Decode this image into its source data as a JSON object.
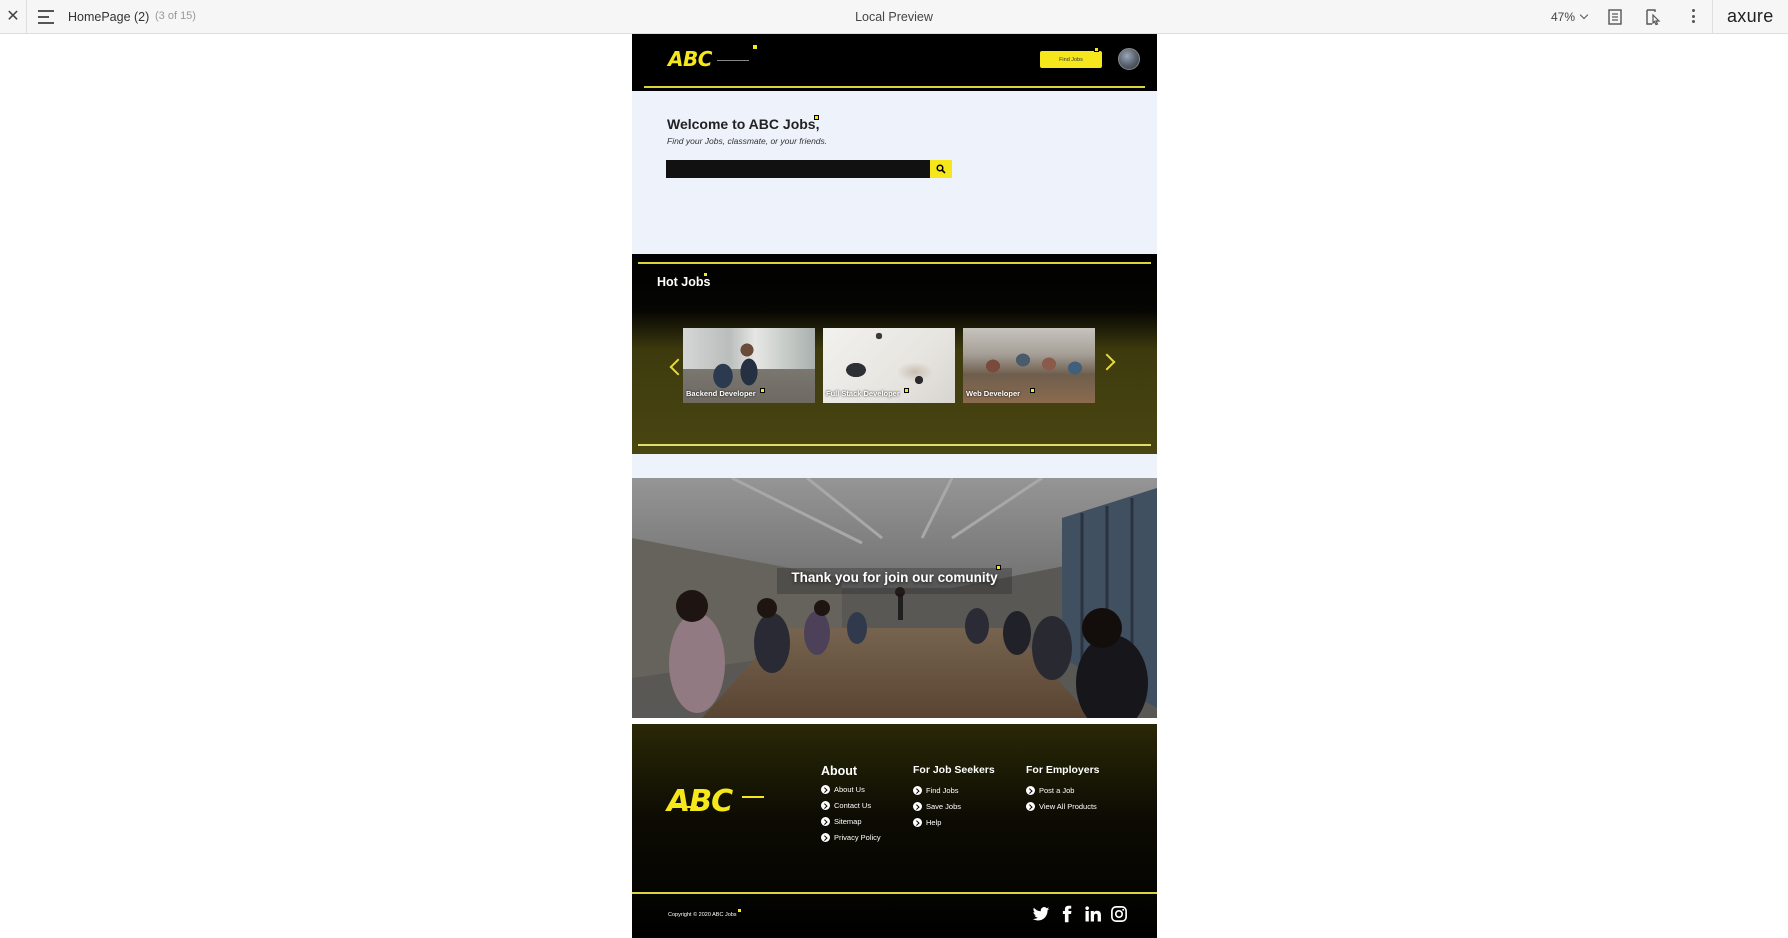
{
  "toolbar": {
    "page_name": "HomePage (2)",
    "page_count": "(3 of 15)",
    "center_title": "Local Preview",
    "zoom": "47%",
    "brand": "axure"
  },
  "site": {
    "logo": "ABC",
    "find_jobs_button": "Find Jobs",
    "welcome_title": "Welcome to ABC Jobs,",
    "welcome_subtitle": "Find your Jobs, classmate, or your friends.",
    "search_placeholder": "",
    "hot_jobs_title": "Hot Jobs",
    "jobs": [
      {
        "title": "Backend Developer"
      },
      {
        "title": "Full Stack Developer"
      },
      {
        "title": "Web Developer"
      }
    ],
    "community_title": "Thank you for join our comunity",
    "footer": {
      "columns": [
        {
          "heading": "About",
          "links": [
            "About Us",
            "Contact Us",
            "Sitemap",
            "Privacy Policy"
          ]
        },
        {
          "heading": "For Job Seekers",
          "links": [
            "Find Jobs",
            "Save Jobs",
            "Help"
          ]
        },
        {
          "heading": "For Employers",
          "links": [
            "Post a Job",
            "View All Products"
          ]
        }
      ],
      "copyright": "Copyright © 2020 ABC Jobs",
      "socials": [
        "twitter-icon",
        "facebook-icon",
        "linkedin-icon",
        "instagram-icon"
      ]
    }
  },
  "colors": {
    "accent_yellow": "#f5e71b",
    "header_bg": "#000000",
    "welcome_bg": "#eef2fb",
    "olive": "#4a4612"
  }
}
